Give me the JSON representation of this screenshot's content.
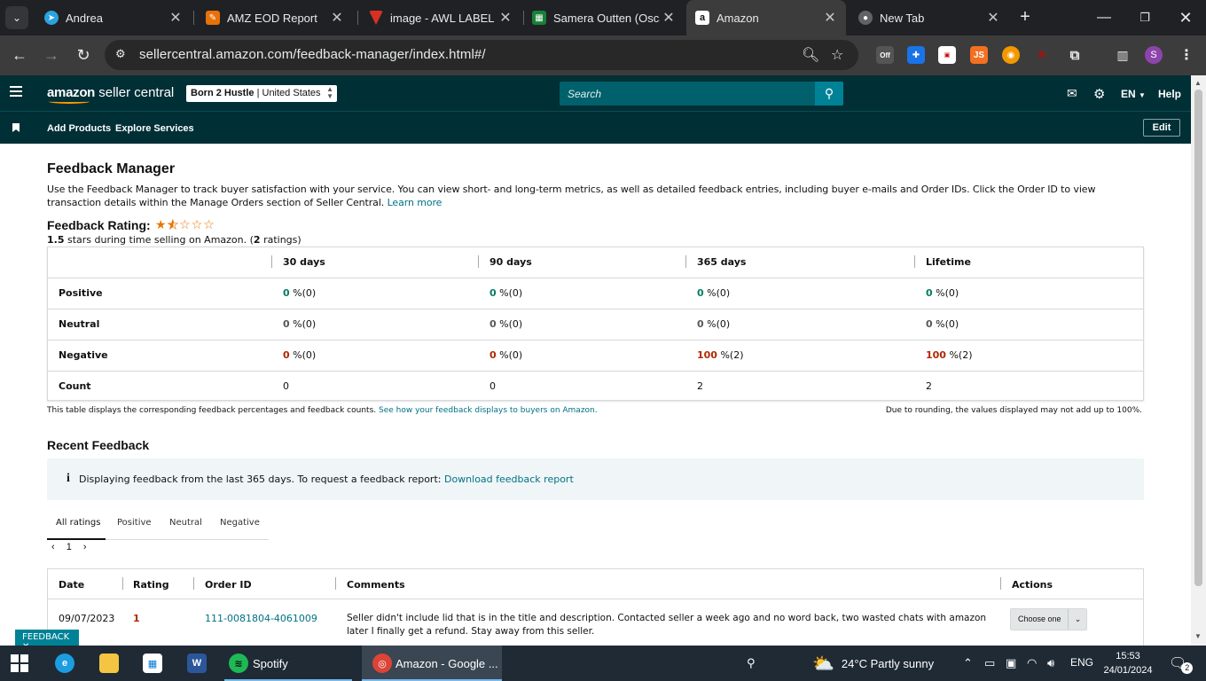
{
  "browser": {
    "tabs": [
      {
        "title": "Andrea",
        "icon": "telegram-icon",
        "color": "#2aa3df"
      },
      {
        "title": "AMZ EOD Report",
        "icon": "tool-icon",
        "color": "#e8710a"
      },
      {
        "title": "image - AWL LABEL",
        "icon": "label-icon",
        "color": "#d93025"
      },
      {
        "title": "Samera Outten (Osca",
        "icon": "sheets-icon",
        "color": "#188038"
      },
      {
        "title": "Amazon",
        "icon": "amazon-icon",
        "color": "#111111"
      },
      {
        "title": "New Tab",
        "icon": "chrome-icon",
        "color": "#8ab4f8"
      }
    ],
    "url": "sellercentral.amazon.com/feedback-manager/index.html#/",
    "extensions": [
      "Off",
      "JS",
      "R"
    ],
    "profile_initial": "S"
  },
  "header": {
    "logo_strong": "amazon",
    "logo_rest": " seller central",
    "store_name": "Born 2 Hustle",
    "store_region": "United States",
    "search_placeholder": "Search",
    "language": "EN",
    "help": "Help"
  },
  "subnav": {
    "links": [
      "Add Products",
      "Explore Services"
    ],
    "edit": "Edit"
  },
  "page": {
    "title": "Feedback Manager",
    "intro": "Use the Feedback Manager to track buyer satisfaction with your service. You can view short- and long-term metrics, as well as detailed feedback entries, including buyer e-mails and Order IDs. Click the Order ID to view transaction details within the Manage Orders section of Seller Central.",
    "learn_more": "Learn more",
    "rating_label": "Feedback Rating:",
    "rating_value": 1.5,
    "rating_max": 5,
    "rating_stars": "1.5",
    "rating_suffix": " stars during time selling on Amazon. (",
    "rating_count": "2",
    "rating_count_suffix": " ratings)"
  },
  "metrics": {
    "headers": [
      "30 days",
      "90 days",
      "365 days",
      "Lifetime"
    ],
    "rows": [
      {
        "label": "Positive",
        "kind": "pos",
        "cells": [
          [
            "0",
            " %(0)"
          ],
          [
            "0",
            " %(0)"
          ],
          [
            "0",
            " %(0)"
          ],
          [
            "0",
            " %(0)"
          ]
        ]
      },
      {
        "label": "Neutral",
        "kind": "neu",
        "cells": [
          [
            "0",
            " %(0)"
          ],
          [
            "0",
            " %(0)"
          ],
          [
            "0",
            " %(0)"
          ],
          [
            "0",
            " %(0)"
          ]
        ]
      },
      {
        "label": "Negative",
        "kind": "neg",
        "cells": [
          [
            "0",
            " %(0)"
          ],
          [
            "0",
            " %(0)"
          ],
          [
            "100",
            " %(2)"
          ],
          [
            "100",
            " %(2)"
          ]
        ]
      },
      {
        "label": "Count",
        "kind": "count",
        "cells": [
          [
            "0",
            ""
          ],
          [
            "0",
            ""
          ],
          [
            "2",
            ""
          ],
          [
            "2",
            ""
          ]
        ]
      }
    ],
    "note": "This table displays the corresponding feedback percentages and feedback counts.",
    "note_link": "See how your feedback displays to buyers on Amazon.",
    "note_right": "Due to rounding, the values displayed may not add up to 100%."
  },
  "recent": {
    "title": "Recent Feedback",
    "info": "Displaying feedback from the last 365 days. To request a feedback report:",
    "info_link": "Download feedback report",
    "tabs": [
      "All ratings",
      "Positive",
      "Neutral",
      "Negative"
    ],
    "page": "1",
    "columns": [
      "Date",
      "Rating",
      "Order ID",
      "Comments",
      "Actions"
    ],
    "rows": [
      {
        "date": "09/07/2023",
        "rating": "1",
        "order_id": "111-0081804-4061009",
        "comment_line1": "Seller didn't include lid that is in the title and description. Contacted seller a week ago and no word back, two wasted chats with amazon",
        "comment_line2": "later I finally get a refund. Stay away from this seller.",
        "action": "Choose one"
      }
    ]
  },
  "feedback_pill": "FEEDBACK ✕",
  "taskbar": {
    "apps": [
      "Spotify",
      "Amazon - Google ..."
    ],
    "weather": "24°C  Partly sunny",
    "lang": "ENG",
    "time": "15:53",
    "date": "24/01/2024",
    "notifications": "2"
  },
  "colors": {
    "header_bg": "#002f36",
    "link": "#007185",
    "positive": "#067d62",
    "negative": "#b12704",
    "accent": "#008296"
  }
}
